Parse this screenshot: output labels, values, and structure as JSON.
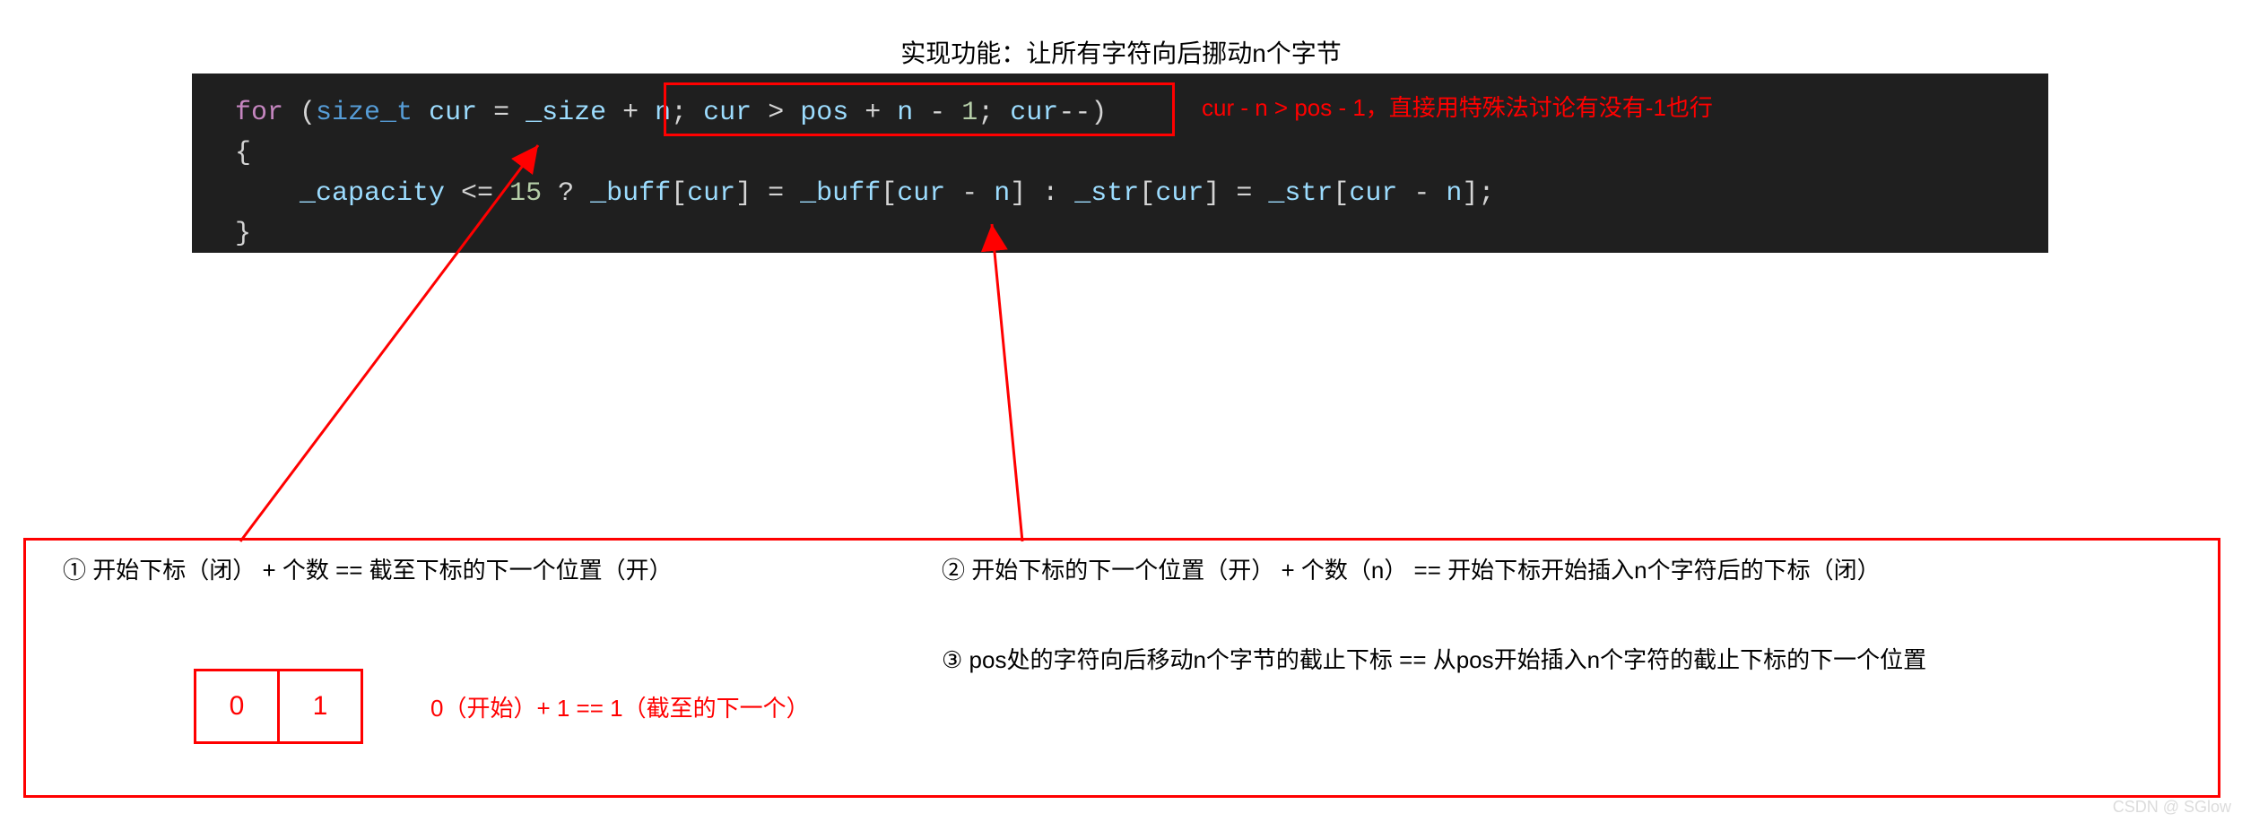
{
  "title": "实现功能：让所有字符向后挪动n个字节",
  "code": {
    "line1": {
      "for": "for",
      "lparen": " (",
      "size_t": "size_t",
      "sp1": " ",
      "cur": "cur",
      "eq": " = ",
      "size": "_size",
      "plus": " + ",
      "n1": "n",
      "semi1": "; ",
      "cur2": "cur",
      "gt": " > ",
      "pos": "pos",
      "plus2": " + ",
      "n2": "n",
      "minus": " - ",
      "one": "1",
      "semi2": "; ",
      "cur3": "cur",
      "dec": "--",
      "rparen": ")"
    },
    "brace_open": "{",
    "line3": {
      "indent": "    ",
      "cap": "_capacity",
      "le": " <= ",
      "fifteen": "15",
      "q": " ? ",
      "buff1": "_buff",
      "lb1": "[",
      "cur4": "cur",
      "rb1": "]",
      "eq2": " = ",
      "buff2": "_buff",
      "lb2": "[",
      "cur5": "cur",
      "minus2": " - ",
      "n3": "n",
      "rb2": "]",
      "colon": " : ",
      "str1": "_str",
      "lb3": "[",
      "cur6": "cur",
      "rb3": "]",
      "eq3": " = ",
      "str2": "_str",
      "lb4": "[",
      "cur7": "cur",
      "minus3": " - ",
      "n4": "n",
      "rb4": "]",
      "semi3": ";"
    },
    "brace_close": "}"
  },
  "annotations": {
    "top": "cur - n > pos - 1，直接用特殊法讨论有没有-1也行",
    "note1": "① 开始下标（闭） + 个数 == 截至下标的下一个位置（开）",
    "note2": "② 开始下标的下一个位置（开） + 个数（n） == 开始下标开始插入n个字符后的下标（闭）",
    "note3": "③ pos处的字符向后移动n个字节的截止下标 == 从pos开始插入n个字符的截止下标的下一个位置",
    "example_anno": "0（开始）+ 1 == 1（截至的下一个）"
  },
  "example_cells": [
    "0",
    "1"
  ],
  "watermark": "CSDN @ SGlow"
}
